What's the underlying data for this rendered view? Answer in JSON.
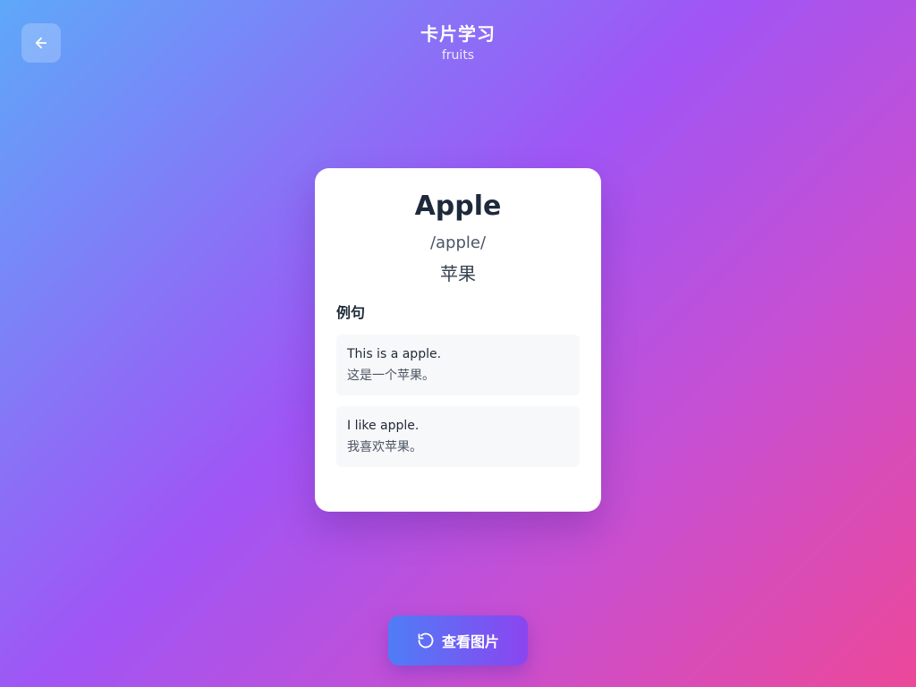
{
  "header": {
    "title": "卡片学习",
    "subtitle": "fruits"
  },
  "card": {
    "word": "Apple",
    "phonetic": "/apple/",
    "meaning": "苹果",
    "examples_title": "例句",
    "examples": [
      {
        "en": "This is a apple.",
        "zh": "这是一个苹果。"
      },
      {
        "en": "I like apple.",
        "zh": "我喜欢苹果。"
      }
    ]
  },
  "actions": {
    "flip_label": "查看图片"
  },
  "icons": {
    "back": "arrow-left-icon",
    "flip": "rotate-ccw-icon"
  },
  "colors": {
    "gradient_start": "#5ea8f9",
    "gradient_mid": "#a055f5",
    "gradient_end": "#ec4899",
    "button_start": "#4f7df6",
    "button_end": "#8b45f0"
  }
}
